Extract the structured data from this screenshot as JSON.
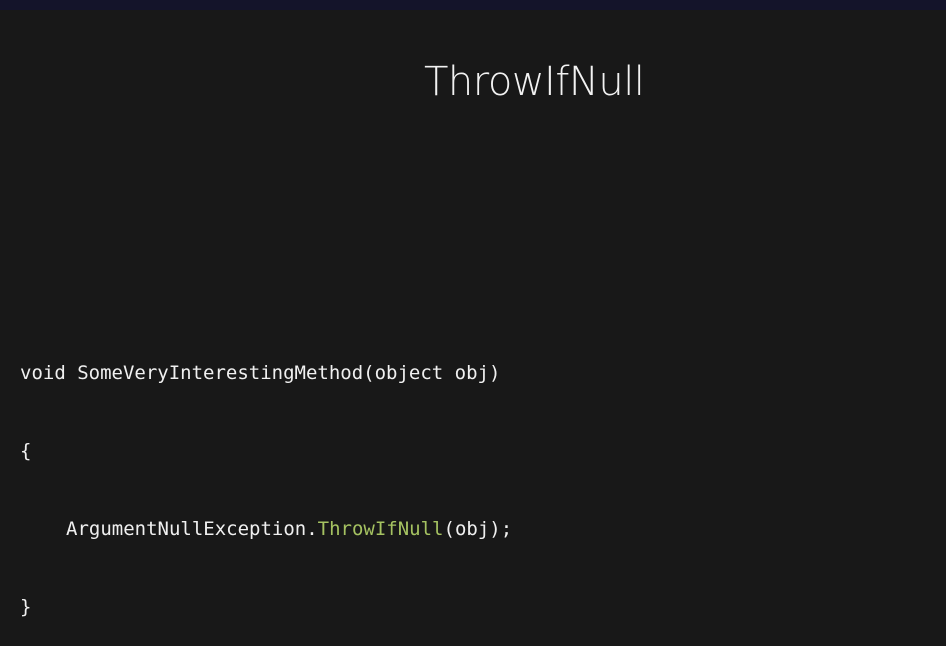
{
  "slide": {
    "title": "ThrowIfNull"
  },
  "code": {
    "line1": "void SomeVeryInterestingMethod(object obj)",
    "line2": "{",
    "line3_prefix": "ArgumentNullException.",
    "line3_method": "ThrowIfNull",
    "line3_suffix": "(obj);",
    "line4": "}"
  },
  "colors": {
    "background": "#181818",
    "top_bar": "#14142a",
    "text": "#f0f0f0",
    "method_highlight": "#a5c261"
  }
}
